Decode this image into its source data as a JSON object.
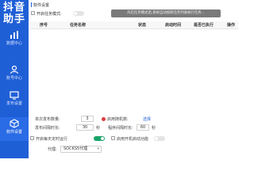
{
  "brand": {
    "line1": "抖音",
    "line2": "助手"
  },
  "sidebar": {
    "items": [
      {
        "label": "数据中心",
        "icon": "bar-chart-icon",
        "active": false
      },
      {
        "label": "账号中心",
        "icon": "user-icon",
        "active": false
      },
      {
        "label": "发布设置",
        "icon": "monitor-icon",
        "active": false
      },
      {
        "label": "软件设置",
        "icon": "settings-cube-icon",
        "active": true
      }
    ]
  },
  "settings": {
    "section_title": "软件设置",
    "auto_task_label": "开启任务模式:",
    "notice": "开启任务模式后,系统自动按照任务列表执行任务..."
  },
  "table": {
    "columns": [
      "序号",
      "任务名称",
      "状态",
      "启动时间",
      "是否已执行",
      "操作"
    ]
  },
  "form": {
    "single_publish_label": "单次发布数量:",
    "single_publish_value": "3",
    "random_label": "启用随机数:",
    "random_link": "选择",
    "interval_label": "发布间隔时长:",
    "interval_value": "30",
    "interval_unit": "秒",
    "program_interval_label": "程序间隔时长:",
    "program_interval_value": "60",
    "program_interval_unit": "秒",
    "scheduled_label": "开启每天定时运行",
    "boot_label": "启用开机启动功能",
    "proxy_label": "代理:",
    "proxy_value": "SOCKS5代理"
  },
  "colors": {
    "sidebar": "#1f5fd6",
    "toggle_on": "#1aa36a",
    "radio": "#e03a3a"
  }
}
